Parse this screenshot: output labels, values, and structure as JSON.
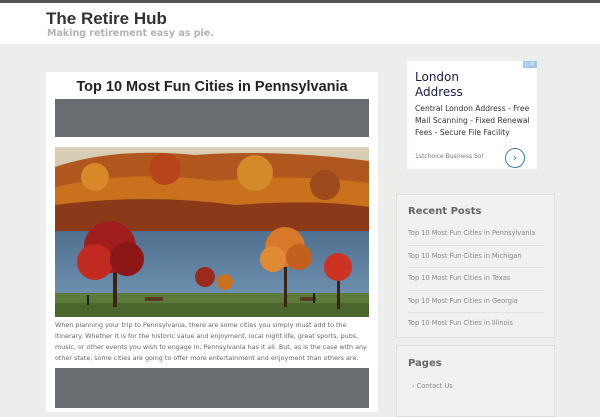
{
  "site": {
    "title": "The Retire Hub",
    "tagline": "Making retirement easy as pie."
  },
  "article": {
    "title": "Top 10 Most Fun Cities in Pennsylvania",
    "excerpt": "When planning your trip to Pennsylvania, there are some cities you simply must add to the itinerary. Whether it is for the historic value and enjoyment, local night life, great sports, pubs, music, or other events you wish to engage in, Pennsylvania has it all. But, as is the case with any other state, some cities are going to offer more entertainment and enjoyment than others are."
  },
  "ad": {
    "title": "London Address",
    "description": "Central London Address - Free Mail Scanning - Fixed Renewal Fees - Secure File Facility",
    "source": "1stchoice Business Sol",
    "arrow_icon": "chevron-right-icon",
    "badge_icon": "ad-choices-icon"
  },
  "sidebar": {
    "recent_posts_title": "Recent Posts",
    "recent_posts": [
      "Top 10 Most Fun Cities in Pennsylvania",
      "Top 10 Most Fun Cities in Michigan",
      "Top 10 Most Fun Cities in Texas",
      "Top 10 Most Fun Cities in Georgia",
      "Top 10 Most Fun Cities in Illinois"
    ],
    "pages_title": "Pages",
    "pages": [
      "› Contact Us"
    ]
  },
  "colors": {
    "placeholder_bar": "#696d72",
    "page_bg": "#eceeec",
    "ad_link": "#3d7ab8"
  }
}
